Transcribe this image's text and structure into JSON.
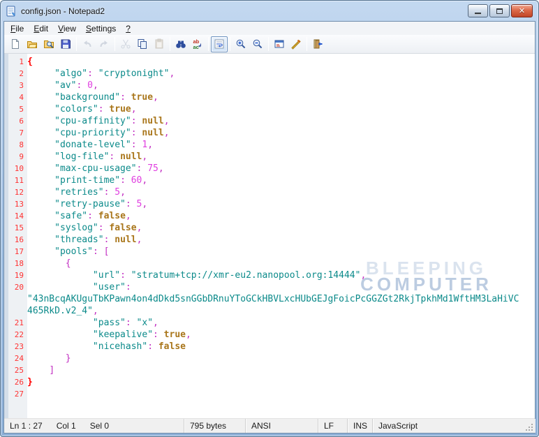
{
  "window": {
    "title": "config.json - Notepad2"
  },
  "menubar": {
    "items": [
      {
        "id": "file",
        "label": "File"
      },
      {
        "id": "edit",
        "label": "Edit"
      },
      {
        "id": "view",
        "label": "View"
      },
      {
        "id": "settings",
        "label": "Settings"
      },
      {
        "id": "help",
        "label": "?"
      }
    ]
  },
  "toolbar": {
    "icons": [
      "new-file",
      "open-file",
      "browse-files",
      "save-file",
      "undo",
      "redo",
      "cut",
      "copy",
      "paste",
      "find",
      "replace",
      "word-wrap",
      "zoom-in",
      "zoom-out",
      "scheme-config",
      "customize-schemes",
      "exit"
    ]
  },
  "watermark": {
    "line1": "BLEEPING",
    "line2": "COMPUTER"
  },
  "editor": {
    "rows": [
      {
        "n": "1",
        "t": [
          [
            "m",
            "{"
          ]
        ]
      },
      {
        "n": "2",
        "t": [
          [
            "w",
            "     "
          ],
          [
            "s",
            "\"algo\""
          ],
          [
            "o",
            ":"
          ],
          [
            "w",
            " "
          ],
          [
            "s",
            "\"cryptonight\""
          ],
          [
            "o",
            ","
          ]
        ]
      },
      {
        "n": "3",
        "t": [
          [
            "w",
            "     "
          ],
          [
            "s",
            "\"av\""
          ],
          [
            "o",
            ":"
          ],
          [
            "w",
            " "
          ],
          [
            "n",
            "0"
          ],
          [
            "o",
            ","
          ]
        ]
      },
      {
        "n": "4",
        "t": [
          [
            "w",
            "     "
          ],
          [
            "s",
            "\"background\""
          ],
          [
            "o",
            ":"
          ],
          [
            "w",
            " "
          ],
          [
            "k",
            "true"
          ],
          [
            "o",
            ","
          ]
        ]
      },
      {
        "n": "5",
        "t": [
          [
            "w",
            "     "
          ],
          [
            "s",
            "\"colors\""
          ],
          [
            "o",
            ":"
          ],
          [
            "w",
            " "
          ],
          [
            "k",
            "true"
          ],
          [
            "o",
            ","
          ]
        ]
      },
      {
        "n": "6",
        "t": [
          [
            "w",
            "     "
          ],
          [
            "s",
            "\"cpu-affinity\""
          ],
          [
            "o",
            ":"
          ],
          [
            "w",
            " "
          ],
          [
            "k",
            "null"
          ],
          [
            "o",
            ","
          ]
        ]
      },
      {
        "n": "7",
        "t": [
          [
            "w",
            "     "
          ],
          [
            "s",
            "\"cpu-priority\""
          ],
          [
            "o",
            ":"
          ],
          [
            "w",
            " "
          ],
          [
            "k",
            "null"
          ],
          [
            "o",
            ","
          ]
        ]
      },
      {
        "n": "8",
        "t": [
          [
            "w",
            "     "
          ],
          [
            "s",
            "\"donate-level\""
          ],
          [
            "o",
            ":"
          ],
          [
            "w",
            " "
          ],
          [
            "n",
            "1"
          ],
          [
            "o",
            ","
          ]
        ]
      },
      {
        "n": "9",
        "t": [
          [
            "w",
            "     "
          ],
          [
            "s",
            "\"log-file\""
          ],
          [
            "o",
            ":"
          ],
          [
            "w",
            " "
          ],
          [
            "k",
            "null"
          ],
          [
            "o",
            ","
          ]
        ]
      },
      {
        "n": "10",
        "t": [
          [
            "w",
            "     "
          ],
          [
            "s",
            "\"max-cpu-usage\""
          ],
          [
            "o",
            ":"
          ],
          [
            "w",
            " "
          ],
          [
            "n",
            "75"
          ],
          [
            "o",
            ","
          ]
        ]
      },
      {
        "n": "11",
        "t": [
          [
            "w",
            "     "
          ],
          [
            "s",
            "\"print-time\""
          ],
          [
            "o",
            ":"
          ],
          [
            "w",
            " "
          ],
          [
            "n",
            "60"
          ],
          [
            "o",
            ","
          ]
        ]
      },
      {
        "n": "12",
        "t": [
          [
            "w",
            "     "
          ],
          [
            "s",
            "\"retries\""
          ],
          [
            "o",
            ":"
          ],
          [
            "w",
            " "
          ],
          [
            "n",
            "5"
          ],
          [
            "o",
            ","
          ]
        ]
      },
      {
        "n": "13",
        "t": [
          [
            "w",
            "     "
          ],
          [
            "s",
            "\"retry-pause\""
          ],
          [
            "o",
            ":"
          ],
          [
            "w",
            " "
          ],
          [
            "n",
            "5"
          ],
          [
            "o",
            ","
          ]
        ]
      },
      {
        "n": "14",
        "t": [
          [
            "w",
            "     "
          ],
          [
            "s",
            "\"safe\""
          ],
          [
            "o",
            ":"
          ],
          [
            "w",
            " "
          ],
          [
            "k",
            "false"
          ],
          [
            "o",
            ","
          ]
        ]
      },
      {
        "n": "15",
        "t": [
          [
            "w",
            "     "
          ],
          [
            "s",
            "\"syslog\""
          ],
          [
            "o",
            ":"
          ],
          [
            "w",
            " "
          ],
          [
            "k",
            "false"
          ],
          [
            "o",
            ","
          ]
        ]
      },
      {
        "n": "16",
        "t": [
          [
            "w",
            "     "
          ],
          [
            "s",
            "\"threads\""
          ],
          [
            "o",
            ":"
          ],
          [
            "w",
            " "
          ],
          [
            "k",
            "null"
          ],
          [
            "o",
            ","
          ]
        ]
      },
      {
        "n": "17",
        "t": [
          [
            "w",
            "     "
          ],
          [
            "s",
            "\"pools\""
          ],
          [
            "o",
            ":"
          ],
          [
            "w",
            " "
          ],
          [
            "o",
            "["
          ]
        ]
      },
      {
        "n": "18",
        "t": [
          [
            "w",
            "       "
          ],
          [
            "o",
            "{"
          ]
        ]
      },
      {
        "n": "19",
        "t": [
          [
            "w",
            "            "
          ],
          [
            "s",
            "\"url\""
          ],
          [
            "o",
            ":"
          ],
          [
            "w",
            " "
          ],
          [
            "s",
            "\"stratum+tcp://xmr-eu2.nanopool.org:14444\""
          ],
          [
            "o",
            ","
          ]
        ]
      },
      {
        "n": "20",
        "t": [
          [
            "w",
            "            "
          ],
          [
            "s",
            "\"user\""
          ],
          [
            "o",
            ":"
          ]
        ]
      },
      {
        "n": "",
        "t": [
          [
            "s",
            "\"43nBcqAKUguTbKPawn4on4dDkd5snGGbDRnuYToGCkHBVLxcHUbGEJgFoicPcGGZGt2RkjTpkhMd1WftHM3LaHiVC"
          ]
        ]
      },
      {
        "n": "",
        "t": [
          [
            "s",
            "465RkD.v2_4\""
          ],
          [
            "o",
            ","
          ]
        ]
      },
      {
        "n": "21",
        "t": [
          [
            "w",
            "            "
          ],
          [
            "s",
            "\"pass\""
          ],
          [
            "o",
            ":"
          ],
          [
            "w",
            " "
          ],
          [
            "s",
            "\"x\""
          ],
          [
            "o",
            ","
          ]
        ]
      },
      {
        "n": "22",
        "t": [
          [
            "w",
            "            "
          ],
          [
            "s",
            "\"keepalive\""
          ],
          [
            "o",
            ":"
          ],
          [
            "w",
            " "
          ],
          [
            "k",
            "true"
          ],
          [
            "o",
            ","
          ]
        ]
      },
      {
        "n": "23",
        "t": [
          [
            "w",
            "            "
          ],
          [
            "s",
            "\"nicehash\""
          ],
          [
            "o",
            ":"
          ],
          [
            "w",
            " "
          ],
          [
            "k",
            "false"
          ]
        ]
      },
      {
        "n": "24",
        "t": [
          [
            "w",
            "       "
          ],
          [
            "o",
            "}"
          ]
        ]
      },
      {
        "n": "25",
        "t": [
          [
            "w",
            "    "
          ],
          [
            "o",
            "]"
          ]
        ]
      },
      {
        "n": "26",
        "t": [
          [
            "m",
            "}"
          ]
        ]
      },
      {
        "n": "27",
        "t": []
      }
    ]
  },
  "statusbar": {
    "position": "Ln 1 : 27",
    "column": "Col 1",
    "selection": "Sel 0",
    "size": "795 bytes",
    "encoding": "ANSI",
    "eol": "LF",
    "mode": "INS",
    "scheme": "JavaScript"
  },
  "colors": {
    "string": "#0B8A8A",
    "number": "#E03EE0",
    "operator": "#C22FC2",
    "keyword": "#A9761B",
    "brace_match": "#FF0000",
    "line_number": "#FF3232",
    "close_button": "#C04526",
    "title_bar": "#AFCBE9",
    "gutter_background": "#EEF1F4",
    "watermark": "#B0C3DC"
  }
}
